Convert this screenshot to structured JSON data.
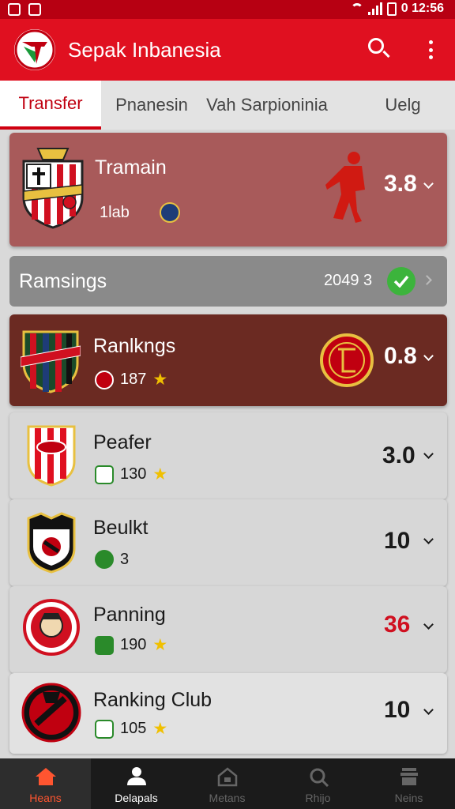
{
  "status_bar": {
    "time": "0 12:56"
  },
  "app": {
    "title": "Sepak Inbanesia"
  },
  "tabs": [
    {
      "label": "Transfer",
      "active": true
    },
    {
      "label": "Pnanesin",
      "active": false
    },
    {
      "label": "Vah Sarpioninia",
      "active": false
    },
    {
      "label": "Uelg",
      "active": false
    }
  ],
  "featured": {
    "name": "Tramain",
    "meta": "1lab",
    "value": "3.8"
  },
  "section": {
    "title": "Ramsings",
    "date": "2049 3"
  },
  "items": [
    {
      "name": "Ranlkngs",
      "meta": "187",
      "value": "0.8",
      "starred": true
    },
    {
      "name": "Peafer",
      "meta": "130",
      "value": "3.0",
      "starred": true
    },
    {
      "name": "Beulkt",
      "meta": "3",
      "value": "10",
      "starred": false
    },
    {
      "name": "Panning",
      "meta": "190",
      "value": "36",
      "starred": true
    },
    {
      "name": "Ranking Club",
      "meta": "105",
      "value": "10",
      "starred": true
    }
  ],
  "bottom_nav": [
    {
      "label": "Heans",
      "active": true
    },
    {
      "label": "Delapals",
      "active": false
    },
    {
      "label": "Metans",
      "active": false
    },
    {
      "label": "Rhijo",
      "active": false
    },
    {
      "label": "Neins",
      "active": false
    }
  ],
  "colors": {
    "accent": "#e01020",
    "dark_card": "#6b2a22",
    "highlight_value": "#d01020"
  }
}
